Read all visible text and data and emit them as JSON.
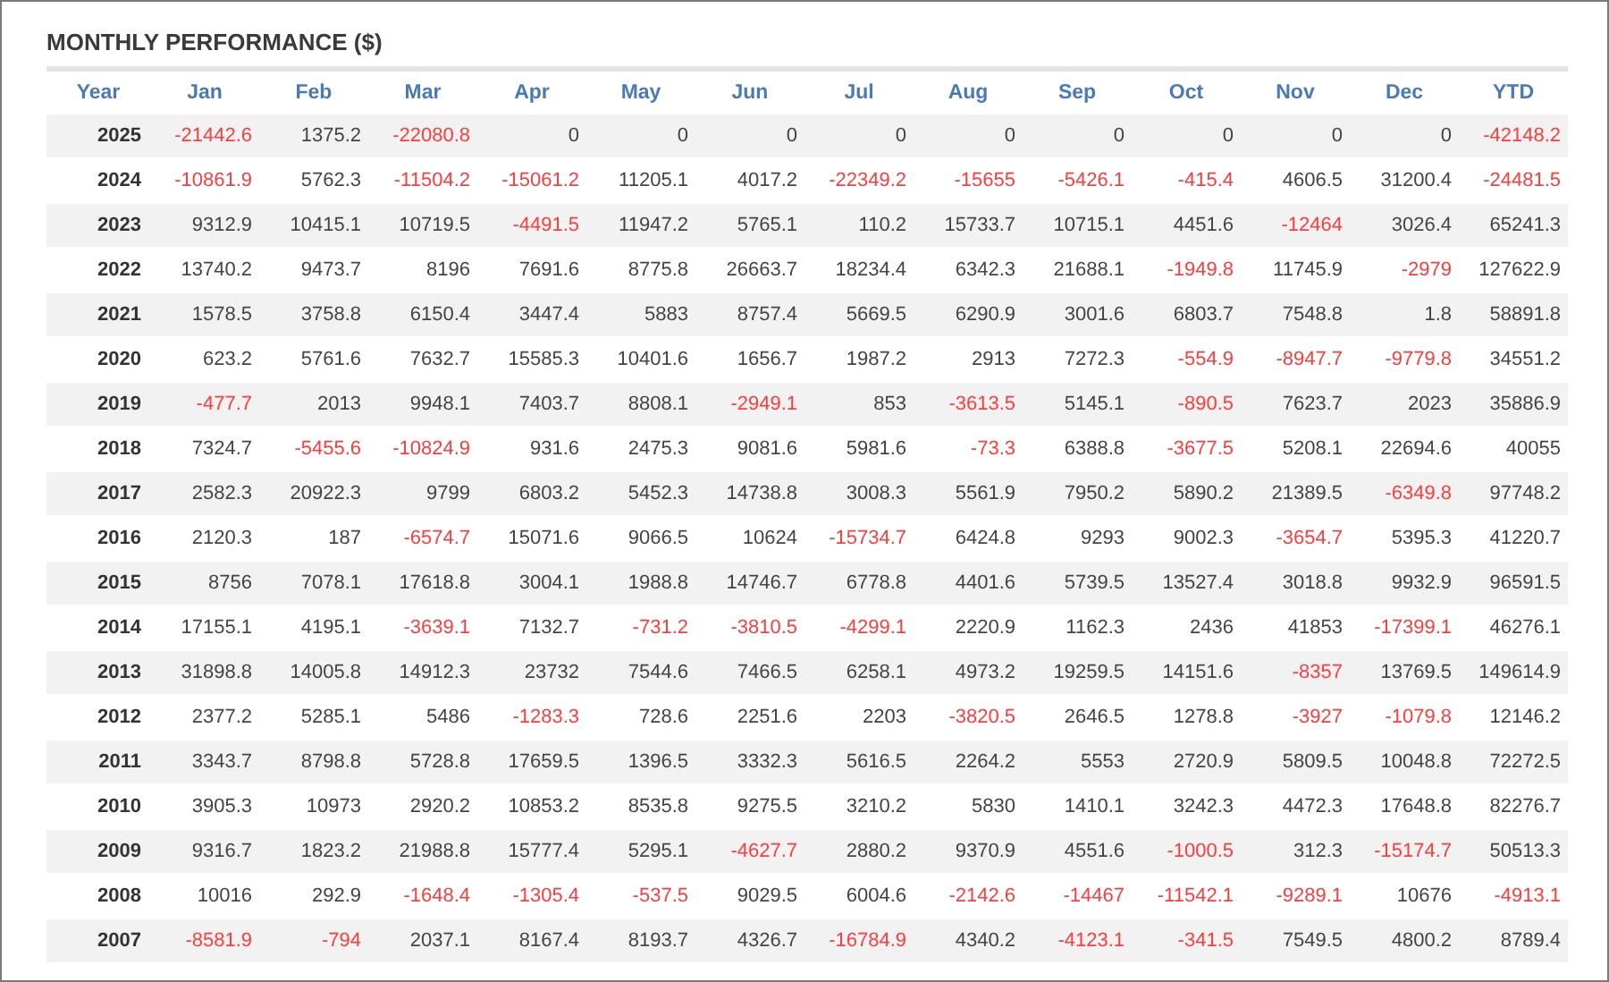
{
  "title": "MONTHLY PERFORMANCE ($)",
  "columns": [
    "Year",
    "Jan",
    "Feb",
    "Mar",
    "Apr",
    "May",
    "Jun",
    "Jul",
    "Aug",
    "Sep",
    "Oct",
    "Nov",
    "Dec",
    "YTD"
  ],
  "rows": [
    {
      "year": "2025",
      "cells": [
        {
          "value": "-21442.6",
          "negative": true
        },
        {
          "value": "1375.2",
          "negative": false
        },
        {
          "value": "-22080.8",
          "negative": true
        },
        {
          "value": "0",
          "negative": false
        },
        {
          "value": "0",
          "negative": false
        },
        {
          "value": "0",
          "negative": false
        },
        {
          "value": "0",
          "negative": false
        },
        {
          "value": "0",
          "negative": false
        },
        {
          "value": "0",
          "negative": false
        },
        {
          "value": "0",
          "negative": false
        },
        {
          "value": "0",
          "negative": false
        },
        {
          "value": "0",
          "negative": false
        },
        {
          "value": "-42148.2",
          "negative": true
        }
      ]
    },
    {
      "year": "2024",
      "cells": [
        {
          "value": "-10861.9",
          "negative": true
        },
        {
          "value": "5762.3",
          "negative": false
        },
        {
          "value": "-11504.2",
          "negative": true
        },
        {
          "value": "-15061.2",
          "negative": true
        },
        {
          "value": "11205.1",
          "negative": false
        },
        {
          "value": "4017.2",
          "negative": false
        },
        {
          "value": "-22349.2",
          "negative": true
        },
        {
          "value": "-15655",
          "negative": true
        },
        {
          "value": "-5426.1",
          "negative": true
        },
        {
          "value": "-415.4",
          "negative": true
        },
        {
          "value": "4606.5",
          "negative": false
        },
        {
          "value": "31200.4",
          "negative": false
        },
        {
          "value": "-24481.5",
          "negative": true
        }
      ]
    },
    {
      "year": "2023",
      "cells": [
        {
          "value": "9312.9",
          "negative": false
        },
        {
          "value": "10415.1",
          "negative": false
        },
        {
          "value": "10719.5",
          "negative": false
        },
        {
          "value": "-4491.5",
          "negative": true
        },
        {
          "value": "11947.2",
          "negative": false
        },
        {
          "value": "5765.1",
          "negative": false
        },
        {
          "value": "110.2",
          "negative": false
        },
        {
          "value": "15733.7",
          "negative": false
        },
        {
          "value": "10715.1",
          "negative": false
        },
        {
          "value": "4451.6",
          "negative": false
        },
        {
          "value": "-12464",
          "negative": true
        },
        {
          "value": "3026.4",
          "negative": false
        },
        {
          "value": "65241.3",
          "negative": false
        }
      ]
    },
    {
      "year": "2022",
      "cells": [
        {
          "value": "13740.2",
          "negative": false
        },
        {
          "value": "9473.7",
          "negative": false
        },
        {
          "value": "8196",
          "negative": false
        },
        {
          "value": "7691.6",
          "negative": false
        },
        {
          "value": "8775.8",
          "negative": false
        },
        {
          "value": "26663.7",
          "negative": false
        },
        {
          "value": "18234.4",
          "negative": false
        },
        {
          "value": "6342.3",
          "negative": false
        },
        {
          "value": "21688.1",
          "negative": false
        },
        {
          "value": "-1949.8",
          "negative": true
        },
        {
          "value": "11745.9",
          "negative": false
        },
        {
          "value": "-2979",
          "negative": true
        },
        {
          "value": "127622.9",
          "negative": false
        }
      ]
    },
    {
      "year": "2021",
      "cells": [
        {
          "value": "1578.5",
          "negative": false
        },
        {
          "value": "3758.8",
          "negative": false
        },
        {
          "value": "6150.4",
          "negative": false
        },
        {
          "value": "3447.4",
          "negative": false
        },
        {
          "value": "5883",
          "negative": false
        },
        {
          "value": "8757.4",
          "negative": false
        },
        {
          "value": "5669.5",
          "negative": false
        },
        {
          "value": "6290.9",
          "negative": false
        },
        {
          "value": "3001.6",
          "negative": false
        },
        {
          "value": "6803.7",
          "negative": false
        },
        {
          "value": "7548.8",
          "negative": false
        },
        {
          "value": "1.8",
          "negative": false
        },
        {
          "value": "58891.8",
          "negative": false
        }
      ]
    },
    {
      "year": "2020",
      "cells": [
        {
          "value": "623.2",
          "negative": false
        },
        {
          "value": "5761.6",
          "negative": false
        },
        {
          "value": "7632.7",
          "negative": false
        },
        {
          "value": "15585.3",
          "negative": false
        },
        {
          "value": "10401.6",
          "negative": false
        },
        {
          "value": "1656.7",
          "negative": false
        },
        {
          "value": "1987.2",
          "negative": false
        },
        {
          "value": "2913",
          "negative": false
        },
        {
          "value": "7272.3",
          "negative": false
        },
        {
          "value": "-554.9",
          "negative": true
        },
        {
          "value": "-8947.7",
          "negative": true
        },
        {
          "value": "-9779.8",
          "negative": true
        },
        {
          "value": "34551.2",
          "negative": false
        }
      ]
    },
    {
      "year": "2019",
      "cells": [
        {
          "value": "-477.7",
          "negative": true
        },
        {
          "value": "2013",
          "negative": false
        },
        {
          "value": "9948.1",
          "negative": false
        },
        {
          "value": "7403.7",
          "negative": false
        },
        {
          "value": "8808.1",
          "negative": false
        },
        {
          "value": "-2949.1",
          "negative": true
        },
        {
          "value": "853",
          "negative": false
        },
        {
          "value": "-3613.5",
          "negative": true
        },
        {
          "value": "5145.1",
          "negative": false
        },
        {
          "value": "-890.5",
          "negative": true
        },
        {
          "value": "7623.7",
          "negative": false
        },
        {
          "value": "2023",
          "negative": false
        },
        {
          "value": "35886.9",
          "negative": false
        }
      ]
    },
    {
      "year": "2018",
      "cells": [
        {
          "value": "7324.7",
          "negative": false
        },
        {
          "value": "-5455.6",
          "negative": true
        },
        {
          "value": "-10824.9",
          "negative": true
        },
        {
          "value": "931.6",
          "negative": false
        },
        {
          "value": "2475.3",
          "negative": false
        },
        {
          "value": "9081.6",
          "negative": false
        },
        {
          "value": "5981.6",
          "negative": false
        },
        {
          "value": "-73.3",
          "negative": true
        },
        {
          "value": "6388.8",
          "negative": false
        },
        {
          "value": "-3677.5",
          "negative": true
        },
        {
          "value": "5208.1",
          "negative": false
        },
        {
          "value": "22694.6",
          "negative": false
        },
        {
          "value": "40055",
          "negative": false
        }
      ]
    },
    {
      "year": "2017",
      "cells": [
        {
          "value": "2582.3",
          "negative": false
        },
        {
          "value": "20922.3",
          "negative": false
        },
        {
          "value": "9799",
          "negative": false
        },
        {
          "value": "6803.2",
          "negative": false
        },
        {
          "value": "5452.3",
          "negative": false
        },
        {
          "value": "14738.8",
          "negative": false
        },
        {
          "value": "3008.3",
          "negative": false
        },
        {
          "value": "5561.9",
          "negative": false
        },
        {
          "value": "7950.2",
          "negative": false
        },
        {
          "value": "5890.2",
          "negative": false
        },
        {
          "value": "21389.5",
          "negative": false
        },
        {
          "value": "-6349.8",
          "negative": true
        },
        {
          "value": "97748.2",
          "negative": false
        }
      ]
    },
    {
      "year": "2016",
      "cells": [
        {
          "value": "2120.3",
          "negative": false
        },
        {
          "value": "187",
          "negative": false
        },
        {
          "value": "-6574.7",
          "negative": true
        },
        {
          "value": "15071.6",
          "negative": false
        },
        {
          "value": "9066.5",
          "negative": false
        },
        {
          "value": "10624",
          "negative": false
        },
        {
          "value": "-15734.7",
          "negative": true
        },
        {
          "value": "6424.8",
          "negative": false
        },
        {
          "value": "9293",
          "negative": false
        },
        {
          "value": "9002.3",
          "negative": false
        },
        {
          "value": "-3654.7",
          "negative": true
        },
        {
          "value": "5395.3",
          "negative": false
        },
        {
          "value": "41220.7",
          "negative": false
        }
      ]
    },
    {
      "year": "2015",
      "cells": [
        {
          "value": "8756",
          "negative": false
        },
        {
          "value": "7078.1",
          "negative": false
        },
        {
          "value": "17618.8",
          "negative": false
        },
        {
          "value": "3004.1",
          "negative": false
        },
        {
          "value": "1988.8",
          "negative": false
        },
        {
          "value": "14746.7",
          "negative": false
        },
        {
          "value": "6778.8",
          "negative": false
        },
        {
          "value": "4401.6",
          "negative": false
        },
        {
          "value": "5739.5",
          "negative": false
        },
        {
          "value": "13527.4",
          "negative": false
        },
        {
          "value": "3018.8",
          "negative": false
        },
        {
          "value": "9932.9",
          "negative": false
        },
        {
          "value": "96591.5",
          "negative": false
        }
      ]
    },
    {
      "year": "2014",
      "cells": [
        {
          "value": "17155.1",
          "negative": false
        },
        {
          "value": "4195.1",
          "negative": false
        },
        {
          "value": "-3639.1",
          "negative": true
        },
        {
          "value": "7132.7",
          "negative": false
        },
        {
          "value": "-731.2",
          "negative": true
        },
        {
          "value": "-3810.5",
          "negative": true
        },
        {
          "value": "-4299.1",
          "negative": true
        },
        {
          "value": "2220.9",
          "negative": false
        },
        {
          "value": "1162.3",
          "negative": false
        },
        {
          "value": "2436",
          "negative": false
        },
        {
          "value": "41853",
          "negative": false
        },
        {
          "value": "-17399.1",
          "negative": true
        },
        {
          "value": "46276.1",
          "negative": false
        }
      ]
    },
    {
      "year": "2013",
      "cells": [
        {
          "value": "31898.8",
          "negative": false
        },
        {
          "value": "14005.8",
          "negative": false
        },
        {
          "value": "14912.3",
          "negative": false
        },
        {
          "value": "23732",
          "negative": false
        },
        {
          "value": "7544.6",
          "negative": false
        },
        {
          "value": "7466.5",
          "negative": false
        },
        {
          "value": "6258.1",
          "negative": false
        },
        {
          "value": "4973.2",
          "negative": false
        },
        {
          "value": "19259.5",
          "negative": false
        },
        {
          "value": "14151.6",
          "negative": false
        },
        {
          "value": "-8357",
          "negative": true
        },
        {
          "value": "13769.5",
          "negative": false
        },
        {
          "value": "149614.9",
          "negative": false
        }
      ]
    },
    {
      "year": "2012",
      "cells": [
        {
          "value": "2377.2",
          "negative": false
        },
        {
          "value": "5285.1",
          "negative": false
        },
        {
          "value": "5486",
          "negative": false
        },
        {
          "value": "-1283.3",
          "negative": true
        },
        {
          "value": "728.6",
          "negative": false
        },
        {
          "value": "2251.6",
          "negative": false
        },
        {
          "value": "2203",
          "negative": false
        },
        {
          "value": "-3820.5",
          "negative": true
        },
        {
          "value": "2646.5",
          "negative": false
        },
        {
          "value": "1278.8",
          "negative": false
        },
        {
          "value": "-3927",
          "negative": true
        },
        {
          "value": "-1079.8",
          "negative": true
        },
        {
          "value": "12146.2",
          "negative": false
        }
      ]
    },
    {
      "year": "2011",
      "cells": [
        {
          "value": "3343.7",
          "negative": false
        },
        {
          "value": "8798.8",
          "negative": false
        },
        {
          "value": "5728.8",
          "negative": false
        },
        {
          "value": "17659.5",
          "negative": false
        },
        {
          "value": "1396.5",
          "negative": false
        },
        {
          "value": "3332.3",
          "negative": false
        },
        {
          "value": "5616.5",
          "negative": false
        },
        {
          "value": "2264.2",
          "negative": false
        },
        {
          "value": "5553",
          "negative": false
        },
        {
          "value": "2720.9",
          "negative": false
        },
        {
          "value": "5809.5",
          "negative": false
        },
        {
          "value": "10048.8",
          "negative": false
        },
        {
          "value": "72272.5",
          "negative": false
        }
      ]
    },
    {
      "year": "2010",
      "cells": [
        {
          "value": "3905.3",
          "negative": false
        },
        {
          "value": "10973",
          "negative": false
        },
        {
          "value": "2920.2",
          "negative": false
        },
        {
          "value": "10853.2",
          "negative": false
        },
        {
          "value": "8535.8",
          "negative": false
        },
        {
          "value": "9275.5",
          "negative": false
        },
        {
          "value": "3210.2",
          "negative": false
        },
        {
          "value": "5830",
          "negative": false
        },
        {
          "value": "1410.1",
          "negative": false
        },
        {
          "value": "3242.3",
          "negative": false
        },
        {
          "value": "4472.3",
          "negative": false
        },
        {
          "value": "17648.8",
          "negative": false
        },
        {
          "value": "82276.7",
          "negative": false
        }
      ]
    },
    {
      "year": "2009",
      "cells": [
        {
          "value": "9316.7",
          "negative": false
        },
        {
          "value": "1823.2",
          "negative": false
        },
        {
          "value": "21988.8",
          "negative": false
        },
        {
          "value": "15777.4",
          "negative": false
        },
        {
          "value": "5295.1",
          "negative": false
        },
        {
          "value": "-4627.7",
          "negative": true
        },
        {
          "value": "2880.2",
          "negative": false
        },
        {
          "value": "9370.9",
          "negative": false
        },
        {
          "value": "4551.6",
          "negative": false
        },
        {
          "value": "-1000.5",
          "negative": true
        },
        {
          "value": "312.3",
          "negative": false
        },
        {
          "value": "-15174.7",
          "negative": true
        },
        {
          "value": "50513.3",
          "negative": false
        }
      ]
    },
    {
      "year": "2008",
      "cells": [
        {
          "value": "10016",
          "negative": false
        },
        {
          "value": "292.9",
          "negative": false
        },
        {
          "value": "-1648.4",
          "negative": true
        },
        {
          "value": "-1305.4",
          "negative": true
        },
        {
          "value": "-537.5",
          "negative": true
        },
        {
          "value": "9029.5",
          "negative": false
        },
        {
          "value": "6004.6",
          "negative": false
        },
        {
          "value": "-2142.6",
          "negative": true
        },
        {
          "value": "-14467",
          "negative": true
        },
        {
          "value": "-11542.1",
          "negative": true
        },
        {
          "value": "-9289.1",
          "negative": true
        },
        {
          "value": "10676",
          "negative": false
        },
        {
          "value": "-4913.1",
          "negative": true
        }
      ]
    },
    {
      "year": "2007",
      "cells": [
        {
          "value": "-8581.9",
          "negative": true
        },
        {
          "value": "-794",
          "negative": true
        },
        {
          "value": "2037.1",
          "negative": false
        },
        {
          "value": "8167.4",
          "negative": false
        },
        {
          "value": "8193.7",
          "negative": false
        },
        {
          "value": "4326.7",
          "negative": false
        },
        {
          "value": "-16784.9",
          "negative": true
        },
        {
          "value": "4340.2",
          "negative": false
        },
        {
          "value": "-4123.1",
          "negative": true
        },
        {
          "value": "-341.5",
          "negative": true
        },
        {
          "value": "7549.5",
          "negative": false
        },
        {
          "value": "4800.2",
          "negative": false
        },
        {
          "value": "8789.4",
          "negative": false
        }
      ]
    }
  ]
}
